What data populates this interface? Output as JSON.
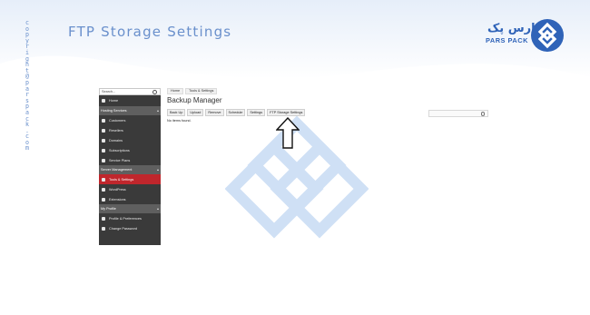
{
  "slide": {
    "title": "FTP Storage Settings",
    "copyright_chars": [
      "c",
      "o",
      "p",
      "y",
      "r",
      "i",
      "g",
      "h",
      "t",
      "@",
      "p",
      "a",
      "r",
      "s",
      "p",
      "a",
      "c",
      "k",
      ".",
      "c",
      "o",
      "m"
    ]
  },
  "logo": {
    "fa_text": "پارس پک",
    "en_text": "PARS PACK"
  },
  "colors": {
    "accent_blue": "#6a90cc",
    "brand_blue": "#2f63b8",
    "active_red": "#c0262c",
    "sidebar_bg": "#3a3a3a"
  },
  "sidebar": {
    "search_placeholder": "Search...",
    "home": "Home",
    "sections": [
      {
        "label": "Hosting Services",
        "items": [
          "Customers",
          "Resellers",
          "Domains",
          "Subscriptions",
          "Service Plans"
        ]
      },
      {
        "label": "Server Management",
        "items": [
          "Tools & Settings",
          "WordPress",
          "Extensions"
        ]
      },
      {
        "label": "My Profile",
        "items": [
          "Profile & Preferences",
          "Change Password"
        ]
      }
    ],
    "active_item": "Tools & Settings"
  },
  "breadcrumb": [
    "Home",
    "Tools & Settings"
  ],
  "main": {
    "heading": "Backup Manager",
    "toolbar": [
      "Back Up",
      "Upload",
      "Remove",
      "Schedule",
      "Settings",
      "FTP Storage Settings"
    ],
    "empty_message": "No items found."
  }
}
